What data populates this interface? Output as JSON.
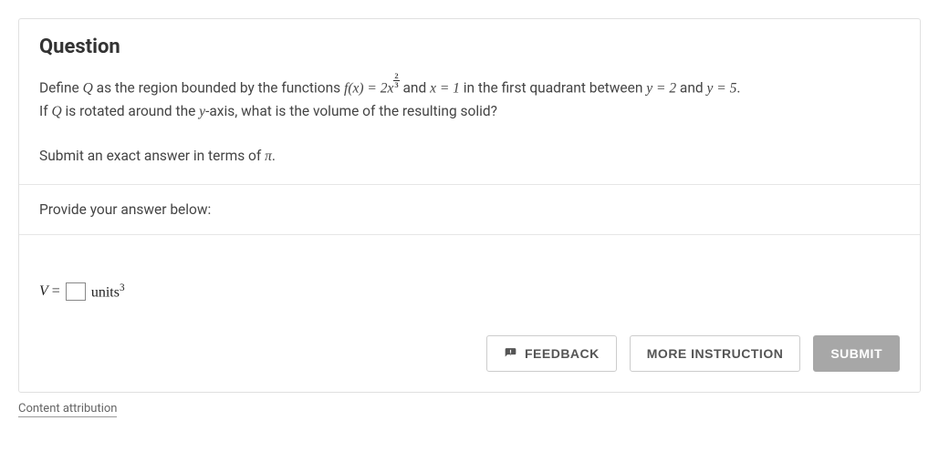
{
  "question": {
    "title": "Question",
    "line1_pre": "Define ",
    "Q": "Q",
    "line1_mid1": " as the region bounded by the functions ",
    "fx": "f(x) = 2x",
    "frac_num": "2",
    "frac_den": "3",
    "line1_mid2": " and ",
    "x_eq": "x = 1",
    "line1_mid3": " in the first quadrant between ",
    "y2": "y = 2",
    "and": " and ",
    "y5": "y = 5",
    "period": ".",
    "line2_pre": "If ",
    "line2_mid": " is rotated around the ",
    "y": "y",
    "line2_post": "-axis, what is the volume of the resulting solid?",
    "hint_pre": "Submit an exact answer in terms of ",
    "pi": "π",
    "hint_post": "."
  },
  "provide": "Provide your answer below:",
  "answer": {
    "V": "V",
    "eq": "=",
    "units": "units",
    "exp": "3"
  },
  "buttons": {
    "feedback": "FEEDBACK",
    "more": "MORE INSTRUCTION",
    "submit": "SUBMIT"
  },
  "attribution": "Content attribution"
}
